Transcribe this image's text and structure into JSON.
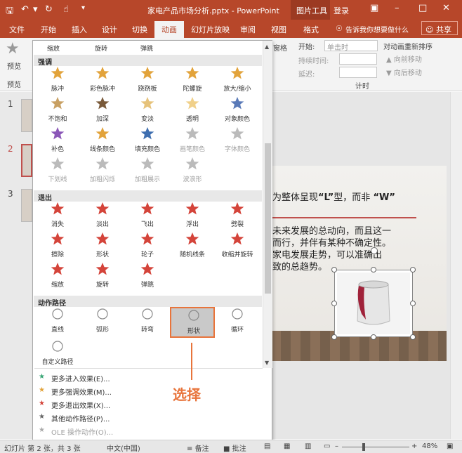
{
  "titlebar": {
    "title": "家电产品市场分析.pptx  -  PowerPoint",
    "context_tools": "图片工具",
    "login": "登录",
    "qa_icons": [
      "save-icon",
      "undo-icon",
      "redo-icon",
      "touch-mode-icon",
      "customize-icon"
    ]
  },
  "tabs": [
    "文件",
    "开始",
    "插入",
    "设计",
    "切换",
    "动画",
    "幻灯片放映",
    "审阅",
    "视图",
    "格式"
  ],
  "active_tab": "动画",
  "tell_me": "告诉我你想要做什么",
  "share": "共享",
  "ribbon": {
    "preview_label": "预览",
    "preview_group": "预览",
    "start_label": "开始:",
    "start_value": "单击时",
    "duration_label": "持续时间:",
    "delay_label": "延迟:",
    "reorder_title": "对动画重新排序",
    "move_earlier": "向前移动",
    "move_later": "向后移动",
    "timing_group": "计时",
    "cut_text": "窗格"
  },
  "thumbnails": [
    {
      "num": "1"
    },
    {
      "num": "2"
    },
    {
      "num": "3"
    }
  ],
  "gallery": {
    "top_row": [
      "缩放",
      "旋转",
      "弹跳"
    ],
    "sections": [
      {
        "title": "强调",
        "rows": [
          [
            {
              "label": "脉冲",
              "color": "#e2a33b"
            },
            {
              "label": "彩色脉冲",
              "color": "#e2a33b"
            },
            {
              "label": "跷跷板",
              "color": "#e2a33b"
            },
            {
              "label": "陀螺旋",
              "color": "#e2a33b"
            },
            {
              "label": "放大/缩小",
              "color": "#e2a33b"
            }
          ],
          [
            {
              "label": "不饱和",
              "color": "#c8a063"
            },
            {
              "label": "加深",
              "color": "#7a5a3a"
            },
            {
              "label": "变淡",
              "color": "#e6c27a"
            },
            {
              "label": "透明",
              "color": "#f0d08a"
            },
            {
              "label": "对象颜色",
              "color": "#5a7ab8"
            }
          ],
          [
            {
              "label": "补色",
              "color": "#8b57b8"
            },
            {
              "label": "线条颜色",
              "color": "#e2a33b"
            },
            {
              "label": "填充颜色",
              "color": "#3f6fb0"
            },
            {
              "label": "画笔颜色",
              "color": "#bbbbbb",
              "dim": true
            },
            {
              "label": "字体颜色",
              "color": "#bbbbbb",
              "dim": true
            }
          ],
          [
            {
              "label": "下划线",
              "color": "#bbbbbb",
              "dim": true
            },
            {
              "label": "加粗闪烁",
              "color": "#bbbbbb",
              "dim": true
            },
            {
              "label": "加粗展示",
              "color": "#bbbbbb",
              "dim": true
            },
            {
              "label": "波浪形",
              "color": "#bbbbbb",
              "dim": true
            }
          ]
        ]
      },
      {
        "title": "退出",
        "rows": [
          [
            {
              "label": "消失",
              "color": "#d4443a"
            },
            {
              "label": "淡出",
              "color": "#d4443a"
            },
            {
              "label": "飞出",
              "color": "#d4443a"
            },
            {
              "label": "浮出",
              "color": "#d4443a"
            },
            {
              "label": "劈裂",
              "color": "#d4443a"
            }
          ],
          [
            {
              "label": "擦除",
              "color": "#d4443a"
            },
            {
              "label": "形状",
              "color": "#d4443a"
            },
            {
              "label": "轮子",
              "color": "#d4443a"
            },
            {
              "label": "随机线条",
              "color": "#d4443a"
            },
            {
              "label": "收缩并旋转",
              "color": "#d4443a"
            }
          ],
          [
            {
              "label": "缩放",
              "color": "#d4443a"
            },
            {
              "label": "旋转",
              "color": "#d4443a"
            },
            {
              "label": "弹跳",
              "color": "#d4443a"
            }
          ]
        ]
      },
      {
        "title": "动作路径",
        "rows": [
          [
            {
              "label": "直线",
              "color": "#888888"
            },
            {
              "label": "弧形",
              "color": "#888888"
            },
            {
              "label": "转弯",
              "color": "#888888"
            },
            {
              "label": "形状",
              "color": "#888888",
              "highlighted": true
            },
            {
              "label": "循环",
              "color": "#888888"
            }
          ],
          [
            {
              "label": "自定义路径",
              "color": "#888888"
            }
          ]
        ]
      }
    ],
    "footer": [
      {
        "label": "更多进入效果(E)...",
        "color": "#3aa676"
      },
      {
        "label": "更多强调效果(M)...",
        "color": "#e2a33b"
      },
      {
        "label": "更多退出效果(X)...",
        "color": "#d4443a"
      },
      {
        "label": "其他动作路径(P)...",
        "color": "#666666"
      },
      {
        "label": "OLE 操作动作(O)...",
        "color": "#aaaaaa",
        "dim": true
      }
    ]
  },
  "callout": "选择",
  "slide": {
    "line1a": "为整体呈现",
    "line1b": "“L”",
    "line1c": "型，而非",
    "line1d": "“W”",
    "line2": "未来发展的总动向，而且这一",
    "line3": "而行，并伴有某种不确定性。",
    "line4": "家电发展走势，可以准确出",
    "line5": "致的总趋势。"
  },
  "status": {
    "slide_info": "幻灯片 第 2 张，共 3 张",
    "language": "中文(中国)",
    "notes": "备注",
    "comments": "批注",
    "zoom": "48%"
  }
}
